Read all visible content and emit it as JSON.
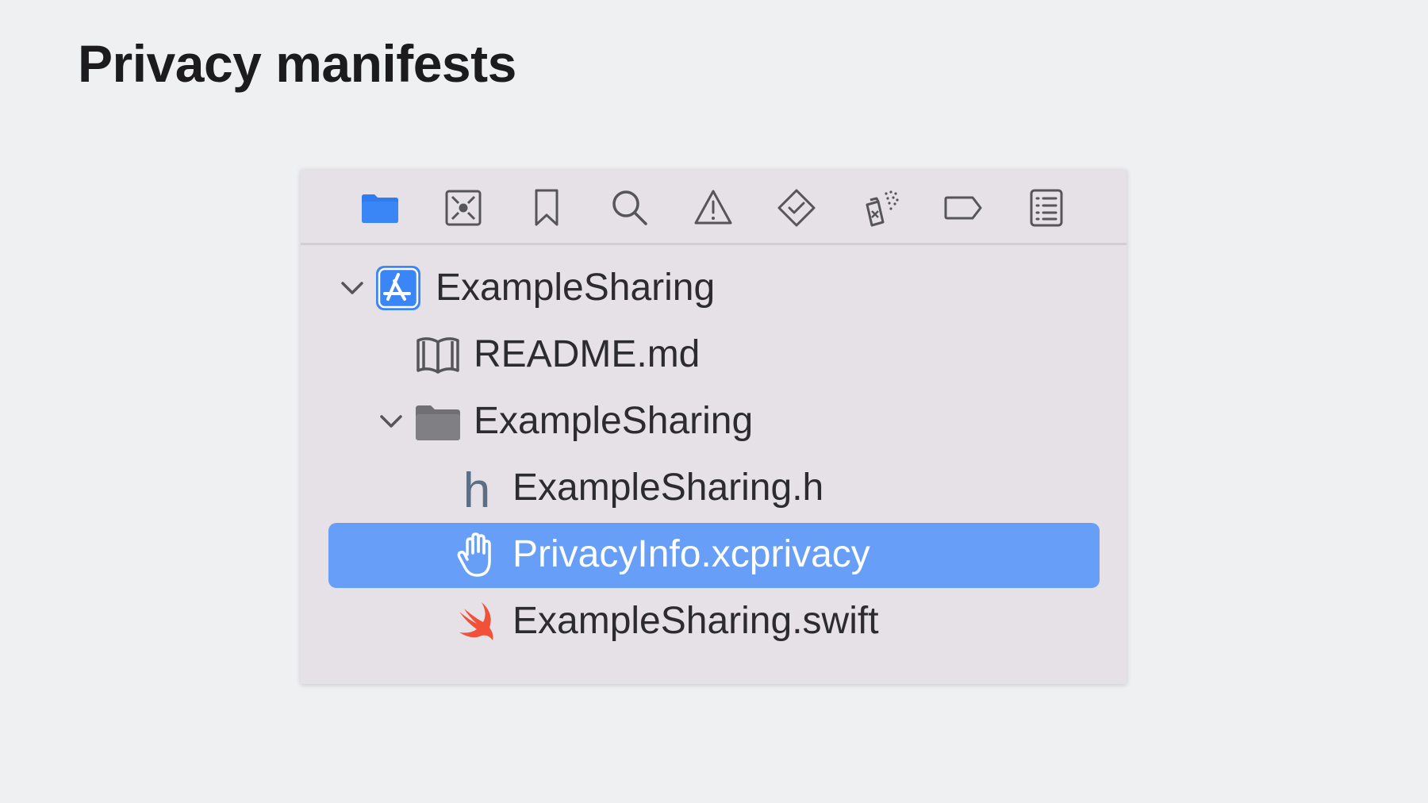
{
  "slide": {
    "title": "Privacy manifests"
  },
  "toolbar": {
    "icons": [
      {
        "name": "project-navigator-folder-icon",
        "active": true
      },
      {
        "name": "source-control-icon"
      },
      {
        "name": "bookmark-icon"
      },
      {
        "name": "find-search-icon"
      },
      {
        "name": "issue-warning-icon"
      },
      {
        "name": "test-diamond-icon"
      },
      {
        "name": "debug-spray-icon"
      },
      {
        "name": "breakpoint-tag-icon"
      },
      {
        "name": "report-list-icon"
      }
    ]
  },
  "tree": {
    "items": [
      {
        "label": "ExampleSharing",
        "icon": "app-project-icon",
        "expanded": true
      },
      {
        "label": "README.md",
        "icon": "book-icon"
      },
      {
        "label": "ExampleSharing",
        "icon": "folder-icon",
        "expanded": true
      },
      {
        "label": "ExampleSharing.h",
        "icon": "header-file-icon"
      },
      {
        "label": "PrivacyInfo.xcprivacy",
        "icon": "hand-privacy-icon",
        "selected": true
      },
      {
        "label": "ExampleSharing.swift",
        "icon": "swift-icon"
      }
    ]
  },
  "colors": {
    "background": "#eff0f2",
    "panel": "#e5e1e6",
    "accent": "#3b82f6",
    "selection": "#679ff8",
    "swift": "#f05138",
    "icon_gray": "#55555a"
  }
}
